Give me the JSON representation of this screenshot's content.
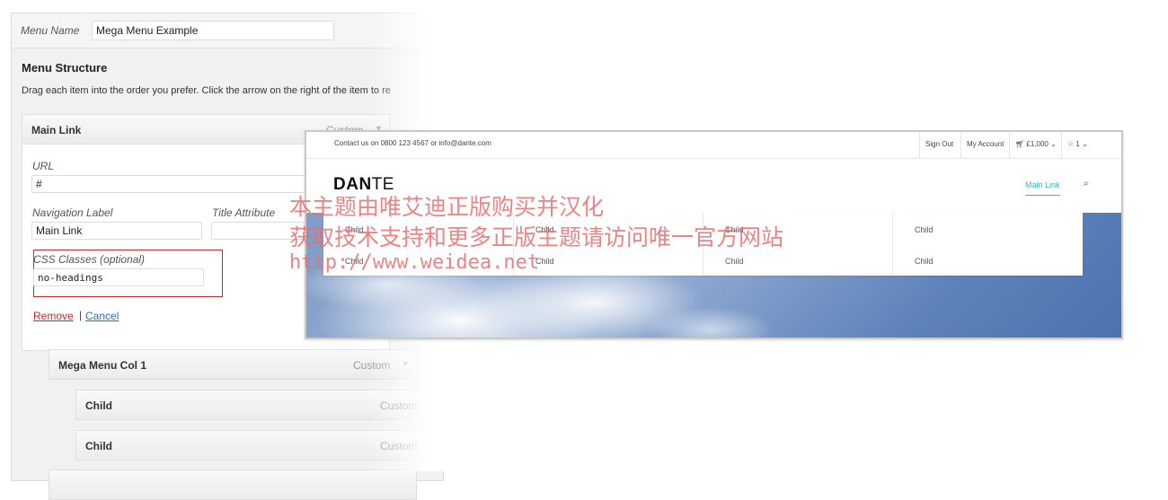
{
  "menu_name": {
    "label": "Menu Name",
    "value": "Mega Menu Example"
  },
  "structure": {
    "heading": "Menu Structure",
    "description": "Drag each item into the order you prefer. Click the arrow on the right of the item to re"
  },
  "main_item": {
    "title": "Main Link",
    "type": "Custom",
    "url_label": "URL",
    "url_value": "#",
    "nav_label_label": "Navigation Label",
    "nav_label_value": "Main Link",
    "title_attr_label": "Title Attribute",
    "title_attr_value": "",
    "css_label": "CSS Classes (optional)",
    "css_value": "no-headings",
    "remove": "Remove",
    "separator": "|",
    "cancel": "Cancel"
  },
  "sub_items": [
    {
      "title": "Mega Menu Col 1",
      "type": "Custom"
    },
    {
      "title": "Child",
      "type": "Custom"
    },
    {
      "title": "Child",
      "type": "Custom"
    }
  ],
  "preview": {
    "contact": "Contact us on 0800 123 4567 or info@dante.com",
    "sign_out": "Sign Out",
    "my_account": "My Account",
    "cart": "£1,000",
    "wishlist": "1",
    "brand_bold": "DAN",
    "brand_light": "TE",
    "nav_main": "Main Link",
    "mega_columns": [
      [
        "Child",
        "Child"
      ],
      [
        "Child",
        "Child"
      ],
      [
        "Child",
        "Child"
      ],
      [
        "Child",
        "Child"
      ]
    ]
  },
  "watermark": {
    "line1": "本主题由唯艾迪正版购买并汉化",
    "line2": "获取技术支持和更多正版主题请访问唯一官方网站",
    "line3": "http://www.weidea.net"
  },
  "colors": {
    "accent": "#2fb7bf",
    "highlight_border": "#c9272d",
    "remove": "#c9272d",
    "link": "#2a6fa8",
    "watermark": "#e86e6e"
  }
}
